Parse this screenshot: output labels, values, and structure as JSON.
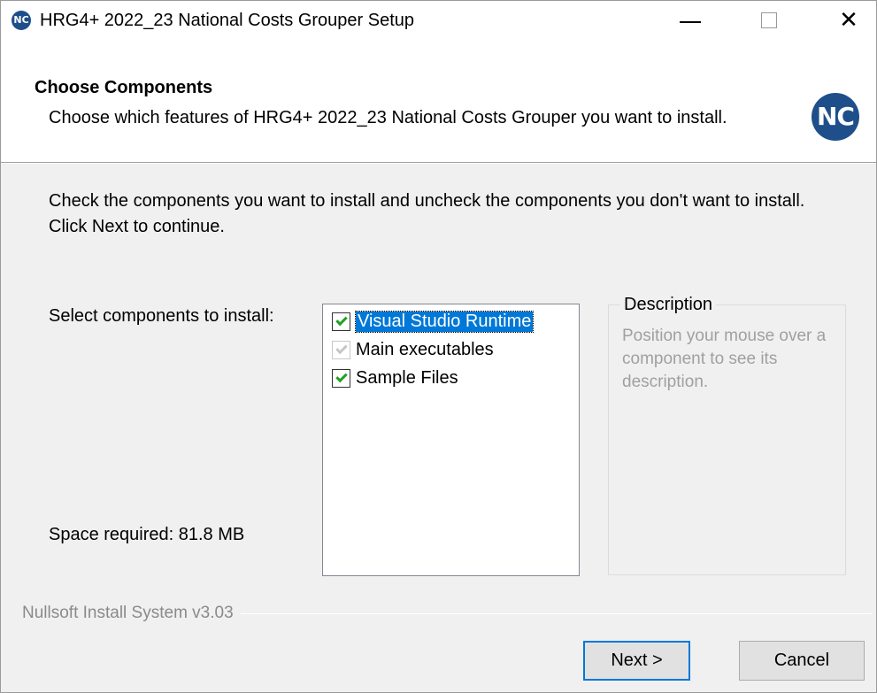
{
  "window": {
    "title": "HRG4+ 2022_23 National Costs Grouper Setup",
    "app_icon_text": "NC",
    "minimize_glyph": "—",
    "close_glyph": "✕"
  },
  "header": {
    "title": "Choose Components",
    "subtitle": "Choose which features of HRG4+ 2022_23 National Costs Grouper you want to install.",
    "logo_text": "NC"
  },
  "body": {
    "intro": "Check the components you want to install and uncheck the components you don't want to install. Click Next to continue.",
    "select_label": "Select components to install:",
    "space_required": "Space required: 81.8 MB"
  },
  "components": [
    {
      "label": "Visual Studio Runtime",
      "checked": true,
      "disabled": false,
      "selected": true
    },
    {
      "label": "Main executables",
      "checked": true,
      "disabled": true,
      "selected": false
    },
    {
      "label": "Sample Files",
      "checked": true,
      "disabled": false,
      "selected": false
    }
  ],
  "description": {
    "legend": "Description",
    "text": "Position your mouse over a component to see its description."
  },
  "footer": {
    "brand": "Nullsoft Install System v3.03",
    "next_label": "Next >",
    "cancel_label": "Cancel"
  },
  "colors": {
    "accent": "#0078d7",
    "check_green": "#21a121",
    "logo_blue": "#1e4f8a"
  }
}
